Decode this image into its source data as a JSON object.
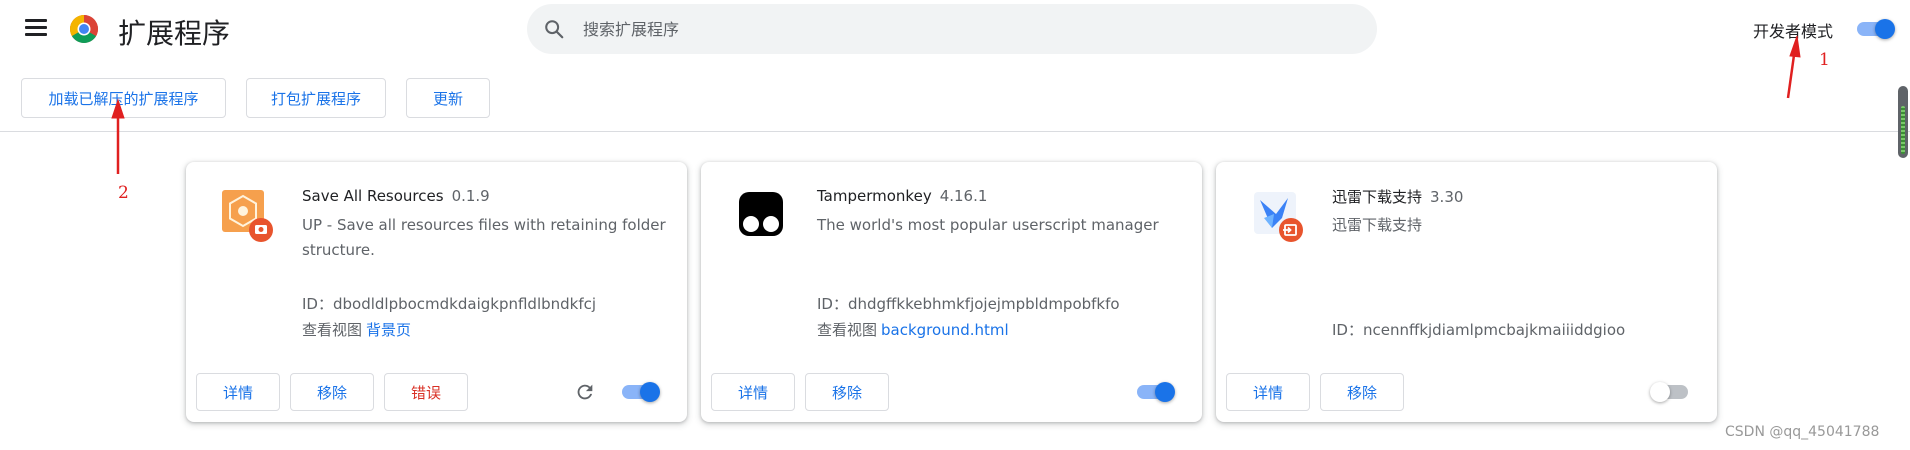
{
  "header": {
    "title": "扩展程序",
    "search_placeholder": "搜索扩展程序",
    "developer_mode_label": "开发者模式",
    "developer_mode_on": true
  },
  "toolbar": {
    "load_unpacked": "加载已解压的扩展程序",
    "pack": "打包扩展程序",
    "update": "更新"
  },
  "extensions": [
    {
      "name": "Save All Resources",
      "version": "0.1.9",
      "description": "UP - Save all resources files with retaining folder structure.",
      "id_label": "ID：",
      "id": "dbodldlpbocmdkdaigkpnfldlbndkfcj",
      "view_label": "查看视图",
      "view_link": "背景页",
      "details": "详情",
      "remove": "移除",
      "errors": "错误",
      "enabled": true,
      "icon": "save-all-resources-icon"
    },
    {
      "name": "Tampermonkey",
      "version": "4.16.1",
      "description": "The world's most popular userscript manager",
      "id_label": "ID：",
      "id": "dhdgffkkebhmkfjojejmpbldmpobfkfo",
      "view_label": "查看视图",
      "view_link": "background.html",
      "details": "详情",
      "remove": "移除",
      "enabled": true,
      "icon": "tampermonkey-icon"
    },
    {
      "name": "迅雷下载支持",
      "version": "3.30",
      "description": "迅雷下载支持",
      "id_label": "ID：",
      "id": "ncennffkjdiamlpmcbajkmaiiiddgioo",
      "details": "详情",
      "remove": "移除",
      "enabled": false,
      "icon": "thunder-download-icon"
    }
  ],
  "annotations": {
    "one": "1",
    "two": "2",
    "color": "#e02020"
  },
  "watermark": "CSDN @qq_45041788",
  "colors": {
    "accent": "#1a73e8",
    "error": "#d93025",
    "toggle_track_on": "#8ab4f8"
  }
}
